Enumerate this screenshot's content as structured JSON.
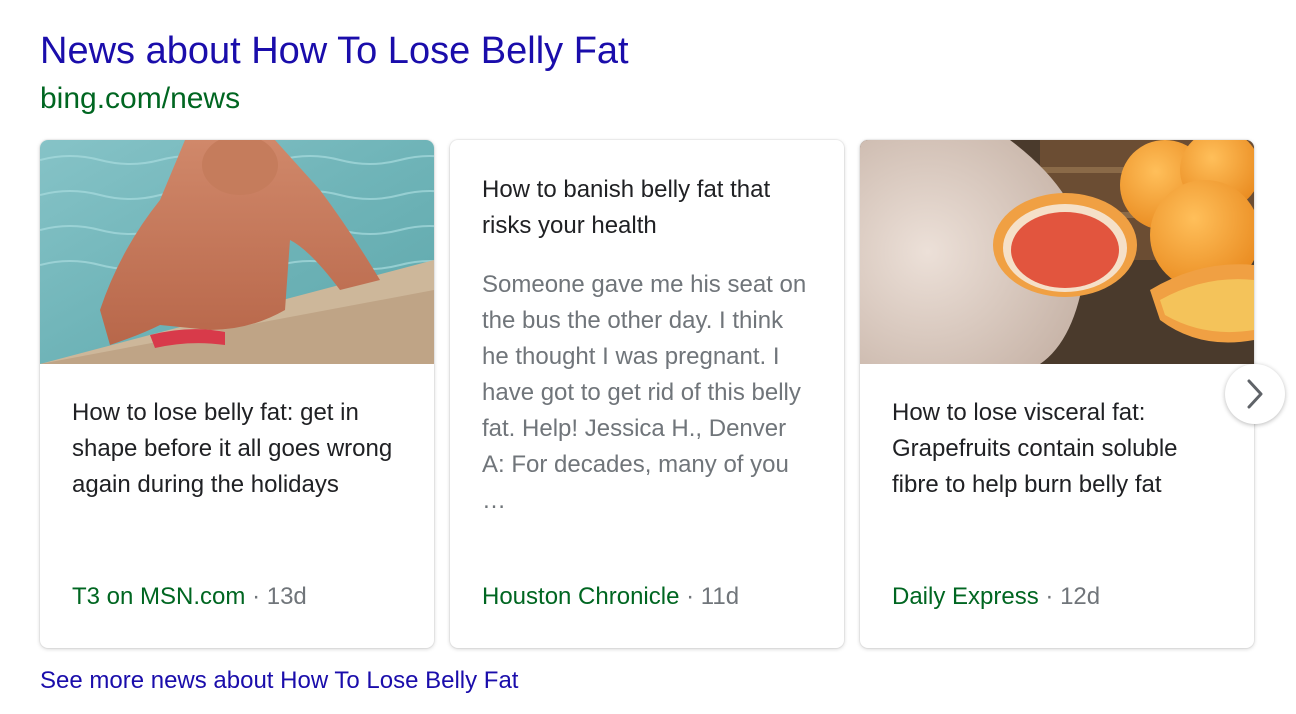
{
  "header": {
    "title": "News about How To Lose Belly Fat",
    "url": "bing.com/news"
  },
  "cards": [
    {
      "image": "man-in-swimming-pool-photo",
      "headline": "How to lose belly fat: get in shape before it all goes wrong again during the holidays",
      "source": "T3 on MSN.com",
      "separator": "·",
      "age": "13d"
    },
    {
      "headline": "How to banish belly fat that risks your health",
      "snippet": "Someone gave me his seat on the bus the other day. I think he thought I was pregnant. I have got to get rid of this belly fat. Help! Jessica H., Denver A: For decades, many of you …",
      "source": "Houston Chronicle",
      "separator": "·",
      "age": "11d"
    },
    {
      "image": "belly-and-grapefruits-photo",
      "headline": "How to lose visceral fat: Grapefruits contain soluble fibre to help burn belly fat",
      "source": "Daily Express",
      "separator": "·",
      "age": "12d"
    }
  ],
  "carousel": {
    "next_icon": "chevron-right-icon"
  },
  "footer": {
    "see_more": "See more news about How To Lose Belly Fat"
  },
  "colors": {
    "link": "#1a0dab",
    "url_green": "#006621",
    "snippet_gray": "#70757a",
    "text": "#202124"
  }
}
